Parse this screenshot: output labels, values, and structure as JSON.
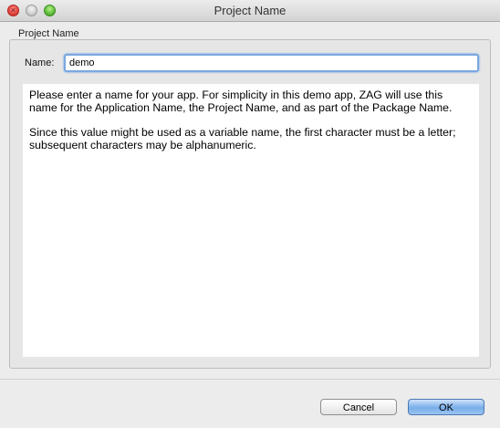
{
  "window": {
    "title": "Project Name",
    "traffic_lights": {
      "close_icon": "close-icon",
      "minimize_icon": "minimize-icon",
      "zoom_icon": "zoom-icon",
      "close_glyph": "×"
    }
  },
  "form": {
    "group_title": "Project Name",
    "name_label": "Name:",
    "name_value": "demo"
  },
  "description": {
    "paragraph1": "Please enter a name for your app. For simplicity in this demo app, ZAG will use this name for the Application Name, the Project Name, and as part of the Package Name.",
    "paragraph2": "Since this value might be used as a variable name, the first character must be a letter; subsequent characters may be alphanumeric."
  },
  "buttons": {
    "cancel_label": "Cancel",
    "ok_label": "OK"
  },
  "colors": {
    "window_bg": "#ececec",
    "focus_ring": "#7aa7e0",
    "default_button": "#79aeea"
  }
}
